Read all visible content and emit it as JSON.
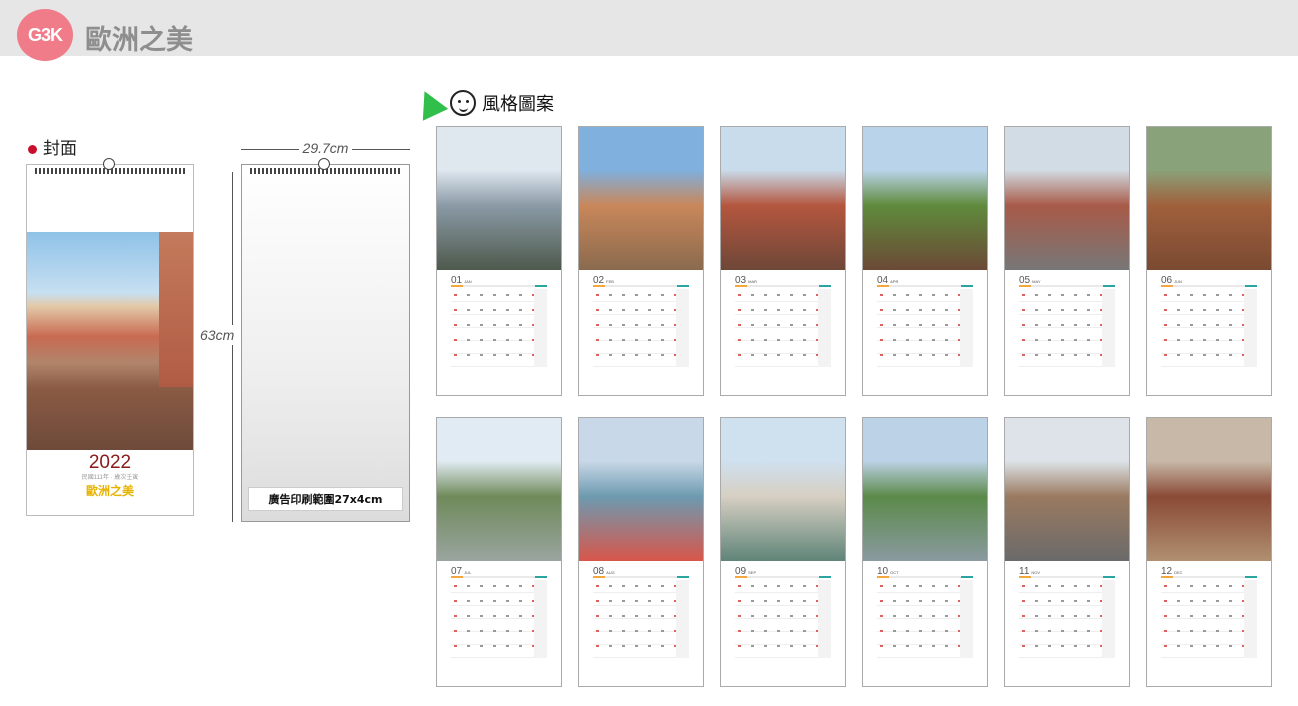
{
  "header": {
    "logo_text": "G3K",
    "brand_title": "歐洲之美"
  },
  "cover": {
    "label": "封面",
    "year": "2022",
    "subtitle": "民國111年 · 歲次壬寅",
    "title": "歐洲之美"
  },
  "dimensions": {
    "width": "29.7cm",
    "height": "63cm"
  },
  "ad_area": {
    "label": "廣告印刷範圍27x4cm"
  },
  "styles": {
    "label": "風格圖案"
  },
  "months": [
    {
      "num": "01",
      "name": "JAN",
      "colors": [
        "#dfe7ef",
        "#8a9aa6",
        "#4e5a4c"
      ]
    },
    {
      "num": "02",
      "name": "FEB",
      "colors": [
        "#7fb0de",
        "#c9875a",
        "#8a6a4e"
      ]
    },
    {
      "num": "03",
      "name": "MAR",
      "colors": [
        "#c9dcec",
        "#b4563e",
        "#6e4738"
      ]
    },
    {
      "num": "04",
      "name": "APR",
      "colors": [
        "#b9d4ea",
        "#5f8a3c",
        "#6b4a36"
      ]
    },
    {
      "num": "05",
      "name": "MAY",
      "colors": [
        "#d2dce4",
        "#a85a48",
        "#777"
      ]
    },
    {
      "num": "06",
      "name": "JUN",
      "colors": [
        "#8aa27a",
        "#a0603c",
        "#7a4a32"
      ]
    },
    {
      "num": "07",
      "name": "JUL",
      "colors": [
        "#e1ebf3",
        "#6f8a5a",
        "#9aa5a0"
      ]
    },
    {
      "num": "08",
      "name": "AUG",
      "colors": [
        "#c8d8e8",
        "#6d9ab0",
        "#d8564a"
      ]
    },
    {
      "num": "09",
      "name": "SEP",
      "colors": [
        "#cfe0ef",
        "#d6cfc2",
        "#5f8478"
      ]
    },
    {
      "num": "10",
      "name": "OCT",
      "colors": [
        "#bcd2e6",
        "#5b8a4a",
        "#8a9aa0"
      ]
    },
    {
      "num": "11",
      "name": "NOV",
      "colors": [
        "#dde3e8",
        "#9a7a60",
        "#6a6a6a"
      ]
    },
    {
      "num": "12",
      "name": "DEC",
      "colors": [
        "#c8b8a8",
        "#8a4a36",
        "#b09070"
      ]
    }
  ]
}
